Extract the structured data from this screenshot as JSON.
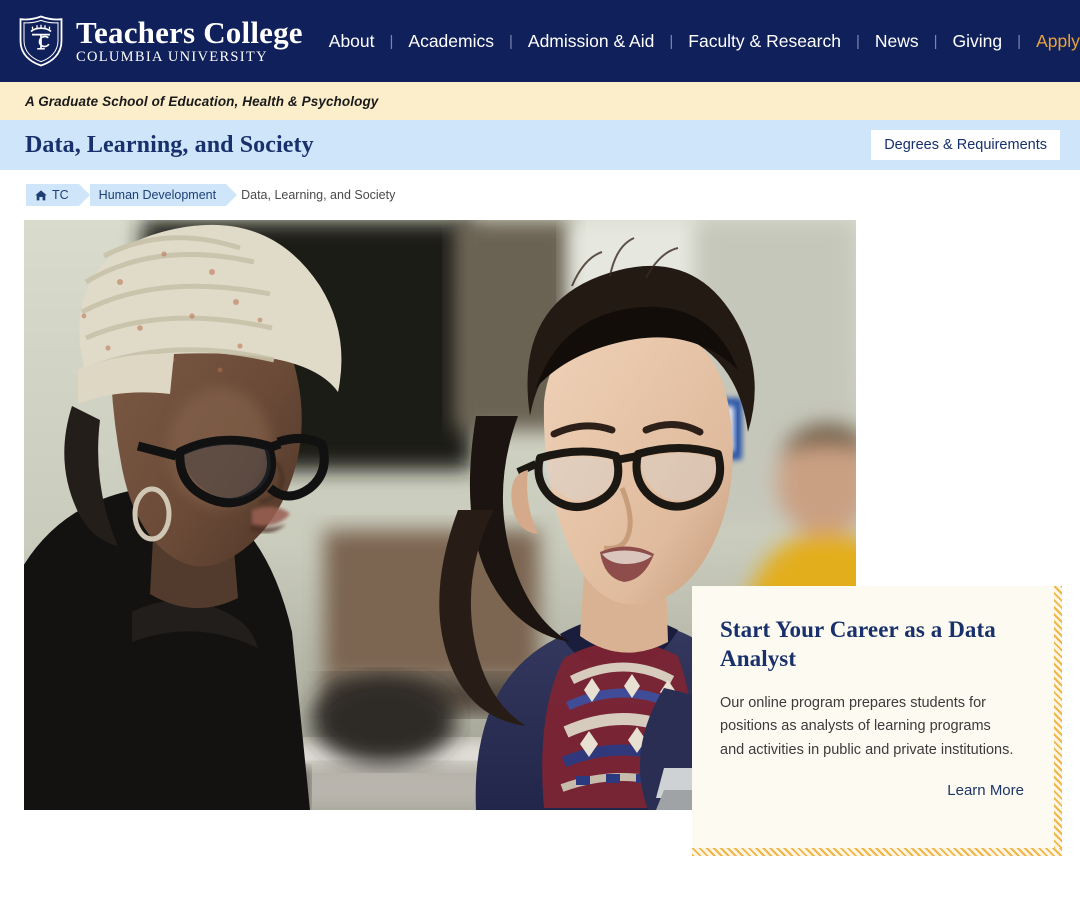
{
  "header": {
    "brand": {
      "logo_icon": "tc-shield-icon",
      "name": "Teachers College",
      "subtitle": "COLUMBIA UNIVERSITY"
    },
    "nav_items": [
      {
        "label": "About",
        "accent": false
      },
      {
        "label": "Academics",
        "accent": false
      },
      {
        "label": "Admission & Aid",
        "accent": false
      },
      {
        "label": "Faculty & Research",
        "accent": false
      },
      {
        "label": "News",
        "accent": false
      },
      {
        "label": "Giving",
        "accent": false
      },
      {
        "label": "Apply",
        "accent": true
      }
    ],
    "separator": "|",
    "colors": {
      "background": "#10205a",
      "text": "#ffffff",
      "accent": "#e8a33d",
      "separator": "#7b86ad"
    }
  },
  "tagline": {
    "text": "A Graduate School of Education, Health & Psychology",
    "background": "#fceecb",
    "text_color": "#1a1a1a"
  },
  "title_band": {
    "title": "Data, Learning, and Society",
    "button_label": "Degrees & Requirements",
    "background": "#cee5fa",
    "title_color": "#18306b",
    "button_background": "#ffffff",
    "button_text_color": "#16306c"
  },
  "breadcrumb": {
    "home_icon": "home-icon",
    "items": [
      {
        "label": "TC",
        "has_home_icon": true,
        "current": false
      },
      {
        "label": "Human Development",
        "has_home_icon": false,
        "current": false
      },
      {
        "label": "Data, Learning, and Society",
        "has_home_icon": false,
        "current": true
      }
    ],
    "chip_background": "#cee5fa",
    "link_color": "#1d3f74",
    "current_color": "#4a4a4a"
  },
  "hero": {
    "image_alt": "Two students working together at laptops in a classroom computer lab",
    "image_description": "Photo of an instructor in a knit beanie and glasses speaking with a student in a patterned sweater typing on a laptop, other students blurred in background"
  },
  "callout": {
    "title": "Start Your Career as a Data Analyst",
    "body": "Our online program prepares students for positions as analysts of learning programs and activities in public and private institutions.",
    "cta_label": "Learn More",
    "background": "#fdfaf1",
    "title_color": "#18306b",
    "body_color": "#3b3b3b",
    "cta_color": "#1d3566",
    "border_accent": "#f0b64a"
  }
}
